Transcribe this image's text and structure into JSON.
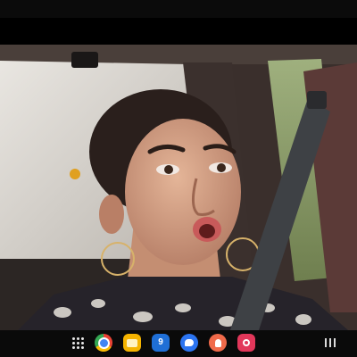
{
  "taskbar": {
    "icons": [
      {
        "name": "apps-grid-icon"
      },
      {
        "name": "chrome-icon"
      },
      {
        "name": "files-icon"
      },
      {
        "name": "calendar-icon",
        "label": "9"
      },
      {
        "name": "messages-icon"
      },
      {
        "name": "contacts-icon"
      },
      {
        "name": "screen-recorder-icon"
      },
      {
        "name": "recent-apps-icon"
      }
    ]
  },
  "colors": {
    "taskbar_bg": "#0a0a0a",
    "files": "#f5b400",
    "calendar": "#1f6fd6",
    "messages": "#2b74f0",
    "contacts": "#f06a4a",
    "camera": "#e2375a"
  }
}
